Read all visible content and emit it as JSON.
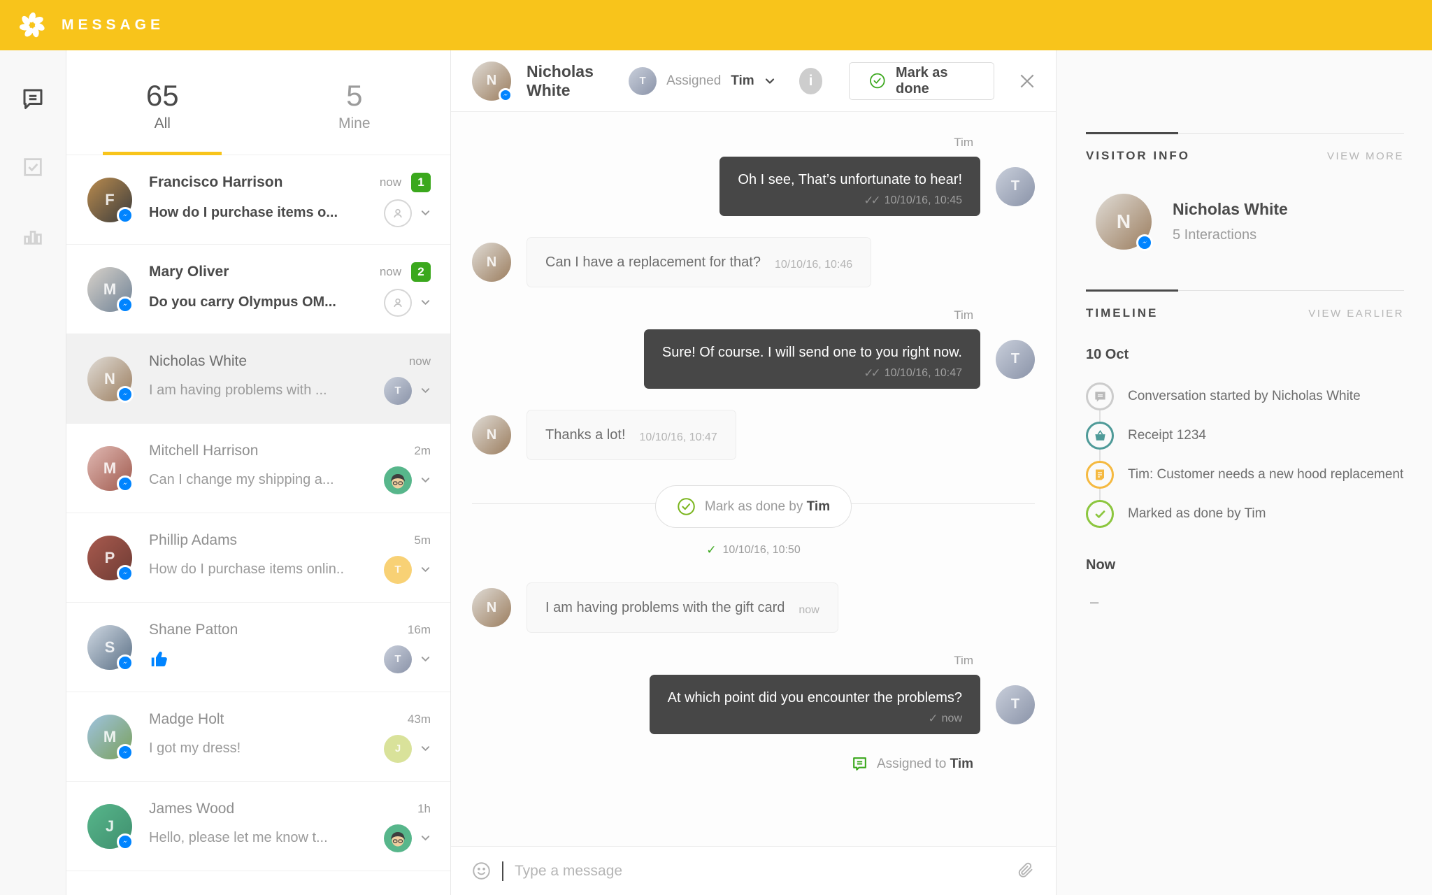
{
  "app": {
    "brand": "MESSAGE"
  },
  "colors": {
    "topbar_yellow": "#F8C41B",
    "unread_green": "#3BA81D",
    "messenger_blue": "#0084FF",
    "bubble_dark": "#474747",
    "timeline_chat_gray": "#cccccc",
    "timeline_receipt_teal": "#4E9A98",
    "timeline_note_yellow": "#F5B940",
    "timeline_done_green": "#8CC63E"
  },
  "tabs": {
    "all_count": "65",
    "all_label": "All",
    "mine_count": "5",
    "mine_label": "Mine"
  },
  "conversations": [
    {
      "name": "Francisco Harrison",
      "preview": "How do I purchase items o...",
      "time": "now",
      "badge": "1",
      "unread": true,
      "selected": false,
      "avatar": {
        "initials": "F",
        "colors": [
          "#b98b4e",
          "#3c3c3c"
        ]
      },
      "assigned": {
        "kind": "unassigned"
      }
    },
    {
      "name": "Mary Oliver",
      "preview": "Do you carry Olympus OM...",
      "time": "now",
      "badge": "2",
      "unread": true,
      "selected": false,
      "avatar": {
        "initials": "M",
        "colors": [
          "#d8d2ca",
          "#6f8296"
        ]
      },
      "assigned": {
        "kind": "unassigned"
      }
    },
    {
      "name": "Nicholas White",
      "preview": "I am having problems with ...",
      "time": "now",
      "badge": "",
      "unread": false,
      "selected": true,
      "avatar": {
        "initials": "N",
        "colors": [
          "#e0dcd6",
          "#9b7d5e"
        ]
      },
      "assigned": {
        "kind": "photo",
        "initials": "T",
        "colors": [
          "#c9cfdb",
          "#8a93a8"
        ]
      }
    },
    {
      "name": "Mitchell Harrison",
      "preview": "Can I change my shipping a...",
      "time": "2m",
      "badge": "",
      "unread": false,
      "selected": false,
      "avatar": {
        "initials": "M",
        "colors": [
          "#e0b9b3",
          "#a05a4e"
        ]
      },
      "assigned": {
        "kind": "cartoon",
        "color": "#57B68B"
      }
    },
    {
      "name": "Phillip Adams",
      "preview": "How do I purchase items onlin..",
      "time": "5m",
      "badge": "",
      "unread": false,
      "selected": false,
      "avatar": {
        "initials": "P",
        "colors": [
          "#a85a4e",
          "#6e3b34"
        ]
      },
      "assigned": {
        "kind": "initial",
        "label": "T",
        "color": "#F8D175"
      }
    },
    {
      "name": "Shane Patton",
      "preview": "",
      "preview_icon": "thumbs-up",
      "time": "16m",
      "badge": "",
      "unread": false,
      "selected": false,
      "avatar": {
        "initials": "S",
        "colors": [
          "#cfd8e2",
          "#5a6f85"
        ]
      },
      "assigned": {
        "kind": "photo",
        "initials": "T",
        "colors": [
          "#c9cfdb",
          "#8a93a8"
        ]
      }
    },
    {
      "name": "Madge Holt",
      "preview": "I got my dress!",
      "time": "43m",
      "badge": "",
      "unread": false,
      "selected": false,
      "avatar": {
        "initials": "M",
        "colors": [
          "#9fc3e0",
          "#7aa05a"
        ]
      },
      "assigned": {
        "kind": "initial",
        "label": "J",
        "color": "#D9E29A"
      }
    },
    {
      "name": "James Wood",
      "preview": "Hello, please let me know t...",
      "time": "1h",
      "badge": "",
      "unread": false,
      "selected": false,
      "avatar": {
        "initials": "J",
        "colors": [
          "#57B68B",
          "#3f8f6e"
        ]
      },
      "assigned": {
        "kind": "cartoon",
        "color": "#57B68B"
      }
    }
  ],
  "chat": {
    "header": {
      "name": "Nicholas White",
      "assigned_label": "Assigned",
      "assigned_agent": "Tim",
      "mark_done_label": "Mark as done"
    },
    "visitor_avatar": {
      "initials": "N",
      "colors": [
        "#e0dcd6",
        "#9b7d5e"
      ]
    },
    "agent_avatar": {
      "initials": "T",
      "colors": [
        "#c9cfdb",
        "#8a93a8"
      ]
    },
    "messages": [
      {
        "kind": "agent",
        "author": "Tim",
        "text": "Oh I see, That’s unfortunate to hear!",
        "time": "10/10/16, 10:45",
        "receipt": "double"
      },
      {
        "kind": "visitor",
        "text": "Can I have a replacement for that?",
        "time": "10/10/16, 10:46"
      },
      {
        "kind": "agent",
        "author": "Tim",
        "text": "Sure! Of course. I will send one to you right now.",
        "time": "10/10/16, 10:47",
        "receipt": "double"
      },
      {
        "kind": "visitor",
        "text": "Thanks a lot!",
        "time": "10/10/16, 10:47"
      },
      {
        "kind": "event",
        "text": "Mark as done by",
        "agent": "Tim",
        "time": "10/10/16, 10:50"
      },
      {
        "kind": "visitor",
        "text": "I am having problems with the gift card",
        "time": "now"
      },
      {
        "kind": "agent",
        "author": "Tim",
        "text": "At which point did you encounter the problems?",
        "time": "now",
        "receipt": "single"
      },
      {
        "kind": "note",
        "text": "Assigned to",
        "agent": "Tim"
      }
    ],
    "input": {
      "placeholder": "Type a message"
    }
  },
  "visitor_info": {
    "heading": "VISITOR INFO",
    "action": "VIEW MORE",
    "name": "Nicholas White",
    "meta": "5 Interactions",
    "avatar": {
      "initials": "N",
      "colors": [
        "#e0dcd6",
        "#9b7d5e"
      ]
    }
  },
  "timeline": {
    "heading": "TIMELINE",
    "action": "VIEW EARLIER",
    "date": "10 Oct",
    "events": [
      {
        "icon": "chat-bubble-icon",
        "color": "#cccccc",
        "glyph": "#b9b9b9",
        "text": "Conversation started by Nicholas White"
      },
      {
        "icon": "basket-icon",
        "color": "#4E9A98",
        "glyph": "#4E9A98",
        "text": "Receipt 1234"
      },
      {
        "icon": "note-icon",
        "color": "#F5B940",
        "glyph": "#F5B940",
        "text": "Tim: Customer needs a new hood replacement"
      },
      {
        "icon": "check-icon",
        "color": "#8CC63E",
        "glyph": "#8CC63E",
        "text": "Marked as done by Tim"
      }
    ],
    "now_label": "Now",
    "now_value": "–"
  }
}
